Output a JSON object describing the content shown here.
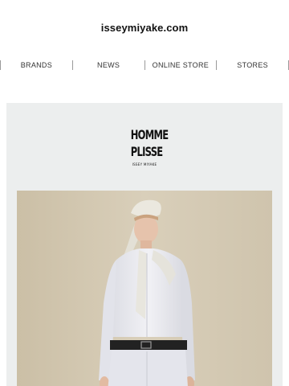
{
  "header": {
    "site_title": "isseymiyake.com"
  },
  "nav": {
    "items": [
      {
        "label": "BRANDS"
      },
      {
        "label": "NEWS"
      },
      {
        "label": "ONLINE STORE"
      },
      {
        "label": "STORES"
      }
    ]
  },
  "hero": {
    "logo": {
      "line1": "HOMME",
      "line2": "PLISSE",
      "line3": "ISSEY MIYAKE"
    }
  },
  "colors": {
    "hero_background": "#eceeee",
    "photo_backdrop": "#d6ccb5",
    "text": "#111111"
  }
}
